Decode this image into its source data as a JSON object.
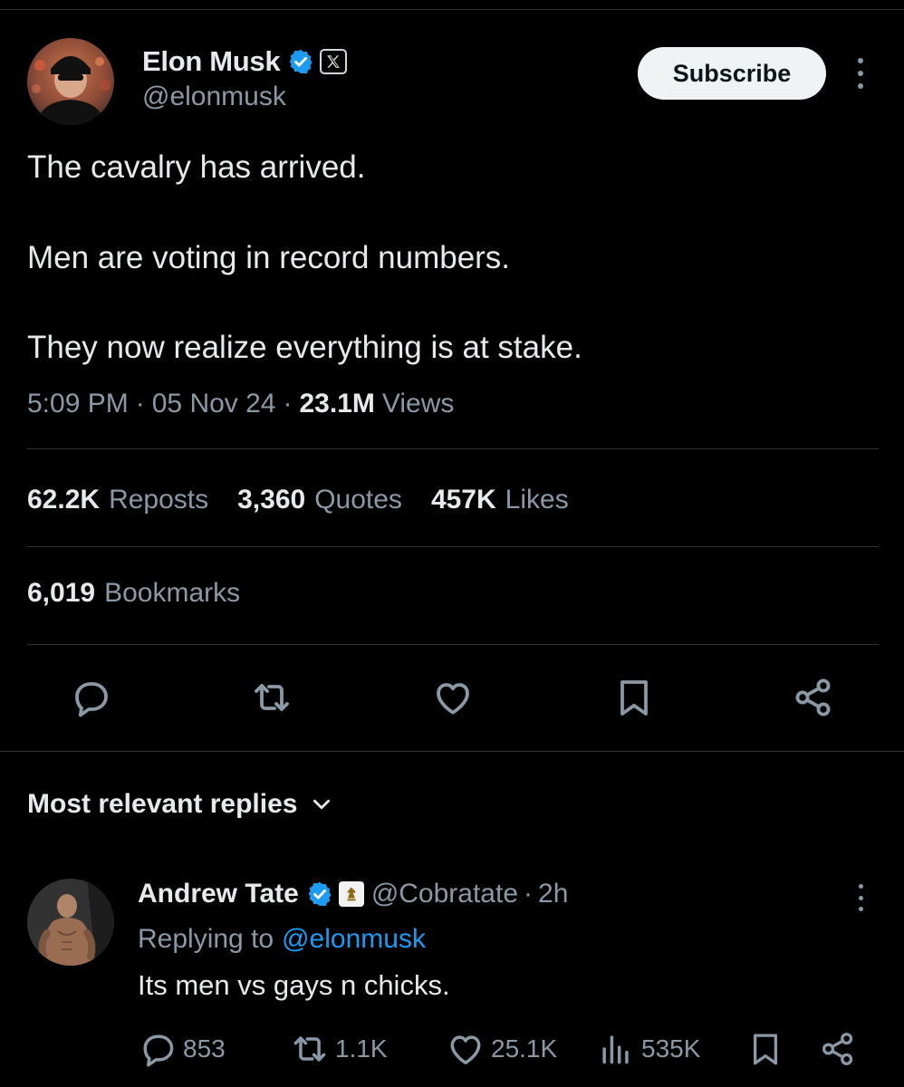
{
  "post": {
    "author": {
      "name": "Elon Musk",
      "handle": "@elonmusk",
      "verified_color": "#1d9bf0",
      "affiliate_badge": "x-logo-icon"
    },
    "subscribe_label": "Subscribe",
    "text_lines": [
      "The cavalry has arrived.",
      "Men are voting in record numbers.",
      "They now realize everything is at stake."
    ],
    "time": "5:09 PM",
    "date": "05 Nov 24",
    "views_count": "23.1M",
    "views_label": "Views",
    "stats": {
      "reposts": {
        "count": "62.2K",
        "label": "Reposts"
      },
      "quotes": {
        "count": "3,360",
        "label": "Quotes"
      },
      "likes": {
        "count": "457K",
        "label": "Likes"
      },
      "bookmarks": {
        "count": "6,019",
        "label": "Bookmarks"
      }
    },
    "actions": [
      "reply-icon",
      "repost-icon",
      "like-icon",
      "bookmark-icon",
      "share-icon"
    ]
  },
  "replies_section": {
    "title": "Most relevant replies"
  },
  "reply": {
    "name": "Andrew Tate",
    "handle": "@Cobratate",
    "time": "2h",
    "replying_prefix": "Replying to",
    "replying_to": "@elonmusk",
    "text": "Its men vs gays n chicks.",
    "counts": {
      "replies": "853",
      "reposts": "1.1K",
      "likes": "25.1K",
      "views": "535K"
    }
  },
  "colors": {
    "background": "#000000",
    "text": "#e7e9ea",
    "secondary": "#8b98a5",
    "link": "#1d9bf0",
    "divider": "#2f3336"
  }
}
